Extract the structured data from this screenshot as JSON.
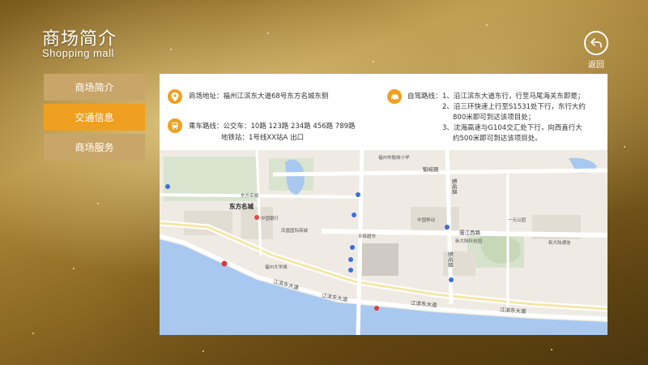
{
  "header": {
    "title_cn": "商场简介",
    "title_en": "Shopping mall",
    "back_label": "返回"
  },
  "menu": [
    {
      "label": "商场简介",
      "active": false
    },
    {
      "label": "交通信息",
      "active": true
    },
    {
      "label": "商场服务",
      "active": false
    }
  ],
  "info": {
    "address": "商场地址：福州江滨东大道68号东方名城东侧",
    "bus": "乘车路线：公交车：10路    123路   234路   456路   789路",
    "metro": "地铁站：1号线XX站A 出口",
    "drive_title": "自驾路线：",
    "drive_lines": [
      "1、沿江滨东大道东行，行至马尾海关东即是；",
      "2、沿三环快速上行至S1531处下行，东行大约",
      "800米即可到达该项目处；",
      "3、沈海高速与G104交汇处下行，向西直行大",
      "约500米即可到达该项目处。"
    ]
  },
  "map": {
    "labels": {
      "dongfang": "东方名城",
      "jiangbin1": "江滨东大道",
      "jiangbin2": "江滨东大道",
      "jiangbin3": "江滨东大道",
      "jiangbin4": "江滨东大道",
      "zhiyuan": "魁岐路",
      "kuiqi1": "魁岐路",
      "kuiqi2": "魁岐路",
      "huaiqi": "儒江西路",
      "l1": "福州市魁岐小学",
      "l2": "东方名城",
      "l3": "中国银行",
      "l4": "凤凰国际商城",
      "l5": "福州大学城",
      "l6": "新大陆科技园",
      "l7": "永辉超市",
      "l8": "中国移动",
      "l9": "一元公园",
      "l10": "新大陆通信"
    }
  },
  "colors": {
    "accent": "#f0a020",
    "menu_inactive": "#c8a568",
    "water": "#a8c8f0"
  }
}
